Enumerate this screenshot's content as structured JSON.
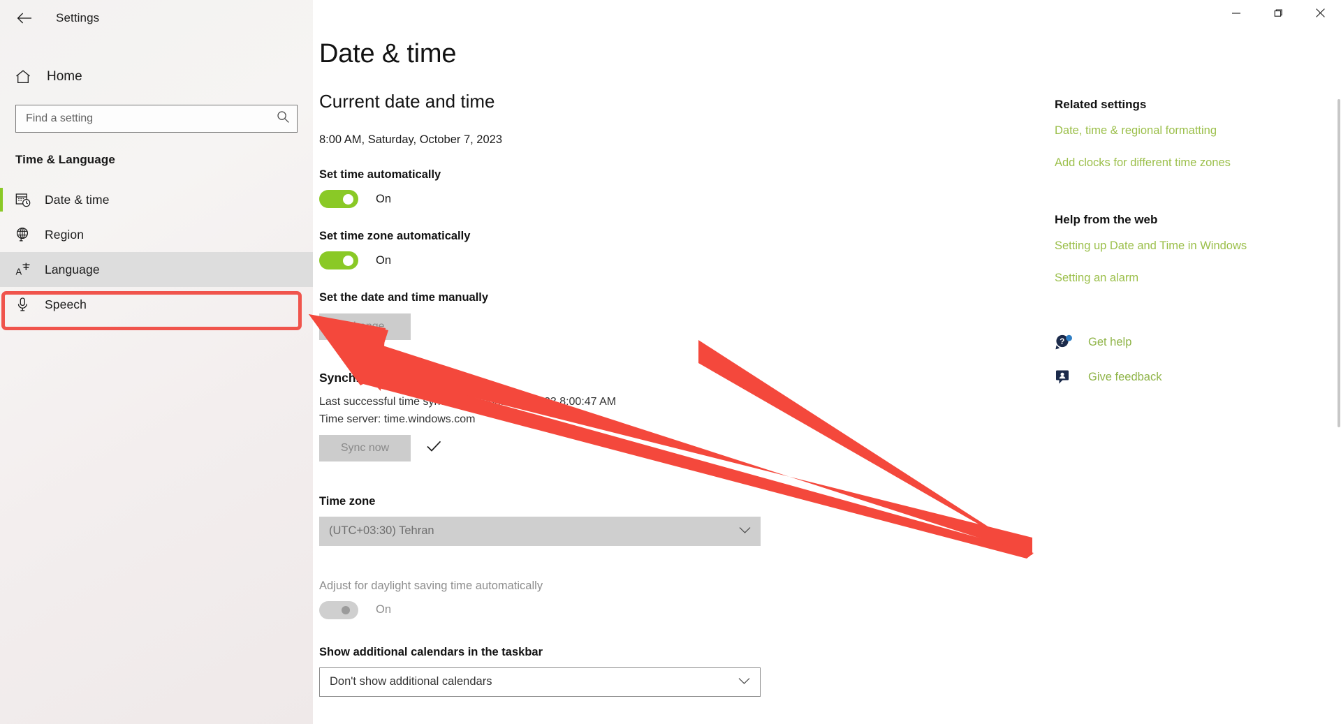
{
  "window": {
    "title": "Settings",
    "back_icon": "back-arrow-icon",
    "controls": {
      "minimize": "minimize-icon",
      "maximize": "maximize-icon",
      "close": "close-icon"
    }
  },
  "sidebar": {
    "home_label": "Home",
    "home_icon": "home-icon",
    "search": {
      "placeholder": "Find a setting",
      "value": "",
      "icon": "search-icon"
    },
    "group_heading": "Time & Language",
    "items": [
      {
        "label": "Date & time",
        "icon": "calendar-clock-icon",
        "selected": true,
        "highlighted": false
      },
      {
        "label": "Region",
        "icon": "globe-icon",
        "selected": false,
        "highlighted": false
      },
      {
        "label": "Language",
        "icon": "language-a-icon",
        "selected": false,
        "highlighted": true
      },
      {
        "label": "Speech",
        "icon": "microphone-icon",
        "selected": false,
        "highlighted": false
      }
    ]
  },
  "main": {
    "page_title": "Date & time",
    "current_section_title": "Current date and time",
    "current_datetime": "8:00 AM, Saturday, October 7, 2023",
    "set_time_auto": {
      "label": "Set time automatically",
      "state": "On",
      "enabled": true
    },
    "set_timezone_auto": {
      "label": "Set time zone automatically",
      "state": "On",
      "enabled": true
    },
    "manual": {
      "label": "Set the date and time manually",
      "change_button": "Change"
    },
    "sync": {
      "title": "Synchronize your clock",
      "last_sync": "Last successful time synchronization: 10/7/2023 8:00:47 AM",
      "time_server": "Time server: time.windows.com",
      "sync_button": "Sync now",
      "status_icon": "checkmark-icon"
    },
    "timezone": {
      "label": "Time zone",
      "value": "(UTC+03:30) Tehran",
      "chevron": "chevron-down-icon"
    },
    "daylight": {
      "label": "Adjust for daylight saving time automatically",
      "state": "On",
      "enabled": false
    },
    "calendars": {
      "label": "Show additional calendars in the taskbar",
      "value": "Don't show additional calendars",
      "chevron": "chevron-down-icon"
    }
  },
  "right_rail": {
    "related_heading": "Related settings",
    "related_links": [
      "Date, time & regional formatting",
      "Add clocks for different time zones"
    ],
    "help_heading": "Help from the web",
    "help_links": [
      "Setting up Date and Time in Windows",
      "Setting an alarm"
    ],
    "support": [
      {
        "label": "Get help",
        "icon": "get-help-icon"
      },
      {
        "label": "Give feedback",
        "icon": "give-feedback-icon"
      }
    ]
  },
  "annotation": {
    "arrow_color": "#f4483c",
    "box_color": "#f0544c",
    "target": "Language"
  },
  "colors": {
    "accent_green": "#8ac926",
    "link_green": "#9bbf4a",
    "annotation_red": "#f4483c"
  }
}
